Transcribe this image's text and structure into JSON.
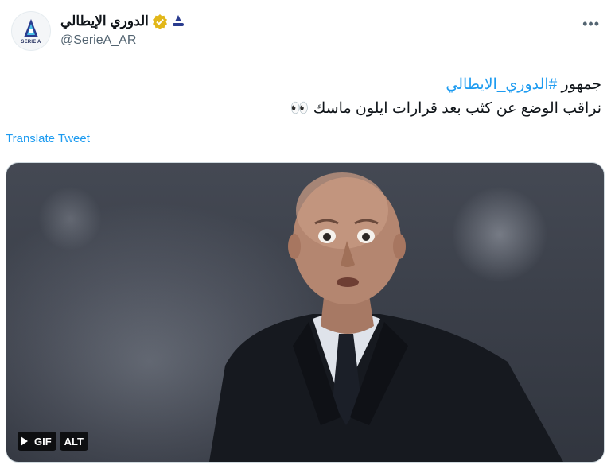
{
  "author": {
    "display_name": "الدوري الإيطالي",
    "handle": "@SerieA_AR",
    "avatar_text": "SERIE A",
    "verified_icon": "verified-badge-gold",
    "affiliate_icon": "affiliate-logo"
  },
  "tweet": {
    "line1_prefix": "جمهور ",
    "hashtag": "#الدوري_الايطالي",
    "line2": "نراقب الوضع عن كثب بعد قرارات ايلون ماسك 👀"
  },
  "translate_label": "Translate Tweet",
  "more_label": "•••",
  "media": {
    "gif_label": "GIF",
    "alt_label": "ALT"
  },
  "colors": {
    "link": "#1d9bf0",
    "verified": "#e2b719"
  }
}
